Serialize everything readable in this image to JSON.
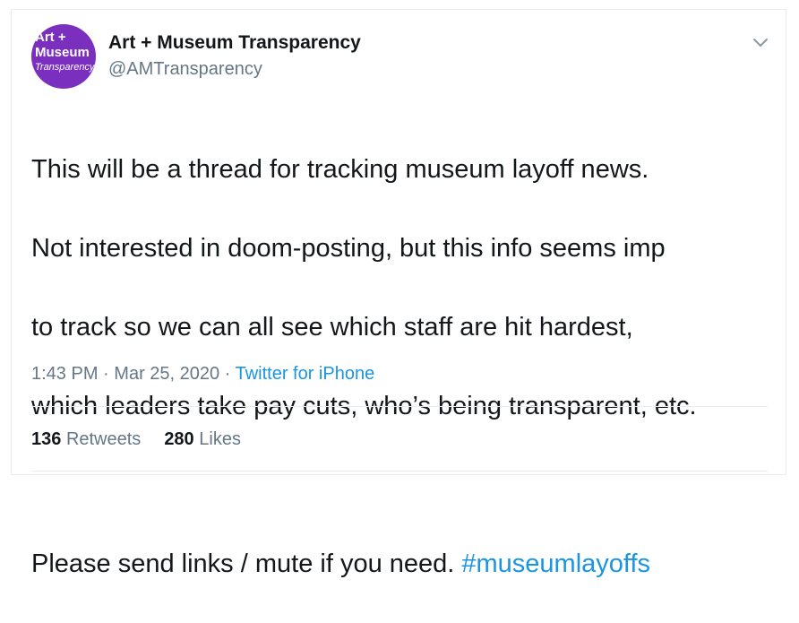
{
  "user": {
    "avatar_lines": [
      "Art +",
      "Museum",
      "Transparency"
    ],
    "display_name": "Art + Museum Transparency",
    "handle": "@AMTransparency"
  },
  "menu": {
    "icon": "chevron-down-icon"
  },
  "tweet": {
    "lines": [
      "This will be a thread for tracking museum layoff news.",
      "Not interested in doom-posting, but this info seems imp",
      "to track so we can all see which staff are hit hardest,",
      "which leaders take pay cuts, who’s being transparent, etc."
    ],
    "last_line_text": "Please send links / mute if you need.",
    "hashtag": "#museumlayoffs",
    "hashtag_color": "#1b95e0"
  },
  "meta": {
    "time": "1:43 PM",
    "separator": "·",
    "date": "Mar 25, 2020",
    "source": "Twitter for iPhone"
  },
  "stats": {
    "retweets_count": "136",
    "retweets_label": "Retweets",
    "likes_count": "280",
    "likes_label": "Likes"
  },
  "colors": {
    "avatar_bg": "#7b2fbf",
    "link": "#1b95e0",
    "secondary_text": "#657786",
    "primary_text": "#14171a",
    "border": "#e6ecf0"
  }
}
